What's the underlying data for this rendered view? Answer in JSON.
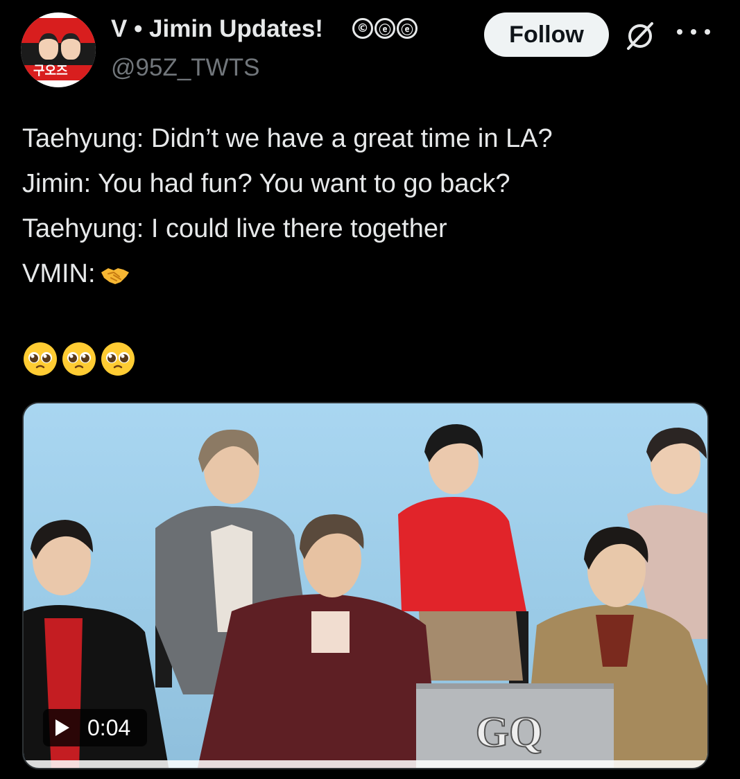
{
  "post": {
    "display_name": "V • Jimin Updates!",
    "badges": [
      "©",
      "ⓔ",
      "ⓔ"
    ],
    "handle": "@95Z_TWTS",
    "follow_label": "Follow",
    "avatar_text": "구오즈",
    "lines": [
      "Taehyung: Didn’t we have a great time in LA?",
      "Jimin: You had fun? You want to go back?",
      "Taehyung: I could live there together",
      "VMIN:"
    ],
    "emoji_row": [
      "pleading-face",
      "pleading-face",
      "pleading-face"
    ]
  },
  "media": {
    "type": "video",
    "duration": "0:04",
    "logo_text": "GQ"
  },
  "colors": {
    "background": "#000000",
    "text": "#e7e9ea",
    "secondary": "#71767b",
    "follow_bg": "#eff3f4"
  }
}
